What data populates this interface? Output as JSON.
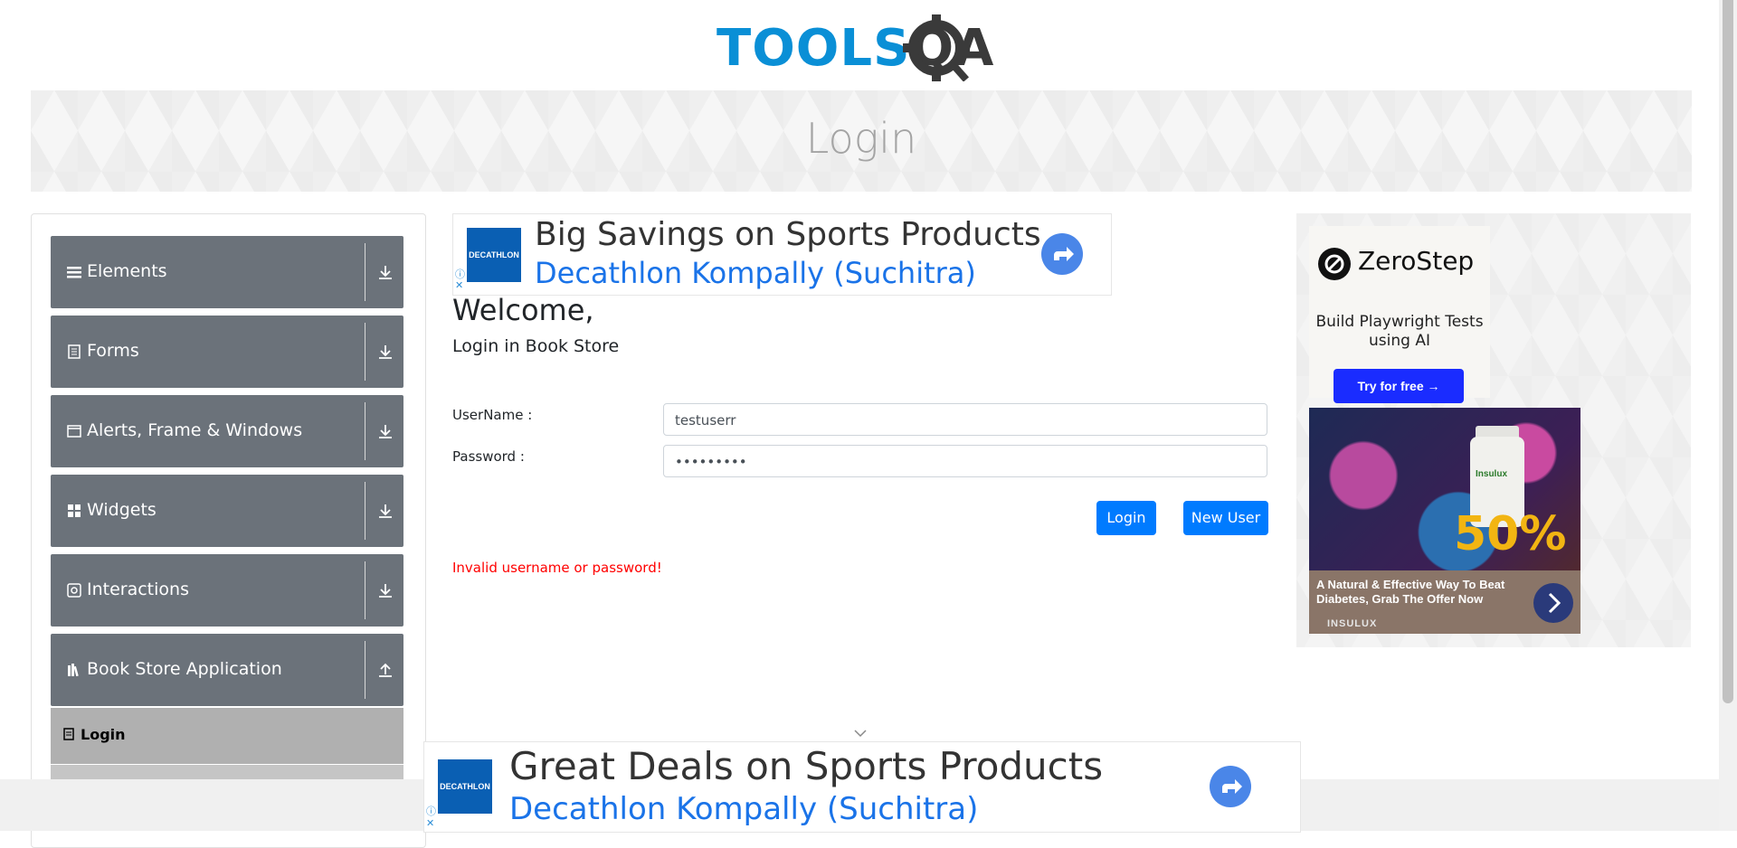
{
  "logo": {
    "part1": "TOOLS",
    "part2": "QA"
  },
  "banner": {
    "title": "Login"
  },
  "sidebar": {
    "groups": [
      {
        "label": "Elements",
        "icon": "menu-icon"
      },
      {
        "label": "Forms",
        "icon": "document-icon"
      },
      {
        "label": "Alerts, Frame & Windows",
        "icon": "window-icon"
      },
      {
        "label": "Widgets",
        "icon": "widgets-icon"
      },
      {
        "label": "Interactions",
        "icon": "interactions-icon"
      },
      {
        "label": "Book Store Application",
        "icon": "books-icon"
      }
    ],
    "active_item": {
      "label": "Login",
      "icon": "login-icon"
    }
  },
  "top_ad": {
    "brand": "DECATHLON",
    "title": "Big Savings on Sports Products",
    "subtitle": "Decathlon Kompally (Suchitra)"
  },
  "form": {
    "welcome": "Welcome,",
    "subheading": "Login in Book Store",
    "username_label": "UserName :",
    "username_value": "testuserr",
    "password_label": "Password :",
    "password_value": "•••••••••",
    "login_button": "Login",
    "new_user_button": "New User",
    "error": "Invalid username or password!"
  },
  "right_ad": {
    "brand": "ZeroStep",
    "description": "Build Playwright Tests using AI",
    "cta": "Try for free →",
    "promo_text": "A Natural & Effective Way To Beat Diabetes, Grab The Offer Now",
    "promo_brand": "INSULUX",
    "promo_badge": "50%",
    "bottle_label": "Insulux"
  },
  "bottom_ad": {
    "brand": "DECATHLON",
    "title": "Great Deals on Sports Products",
    "subtitle": "Decathlon Kompally (Suchitra)"
  },
  "colors": {
    "sidebar_group": "#6b727a",
    "primary": "#007bff",
    "error": "#ff0000"
  }
}
